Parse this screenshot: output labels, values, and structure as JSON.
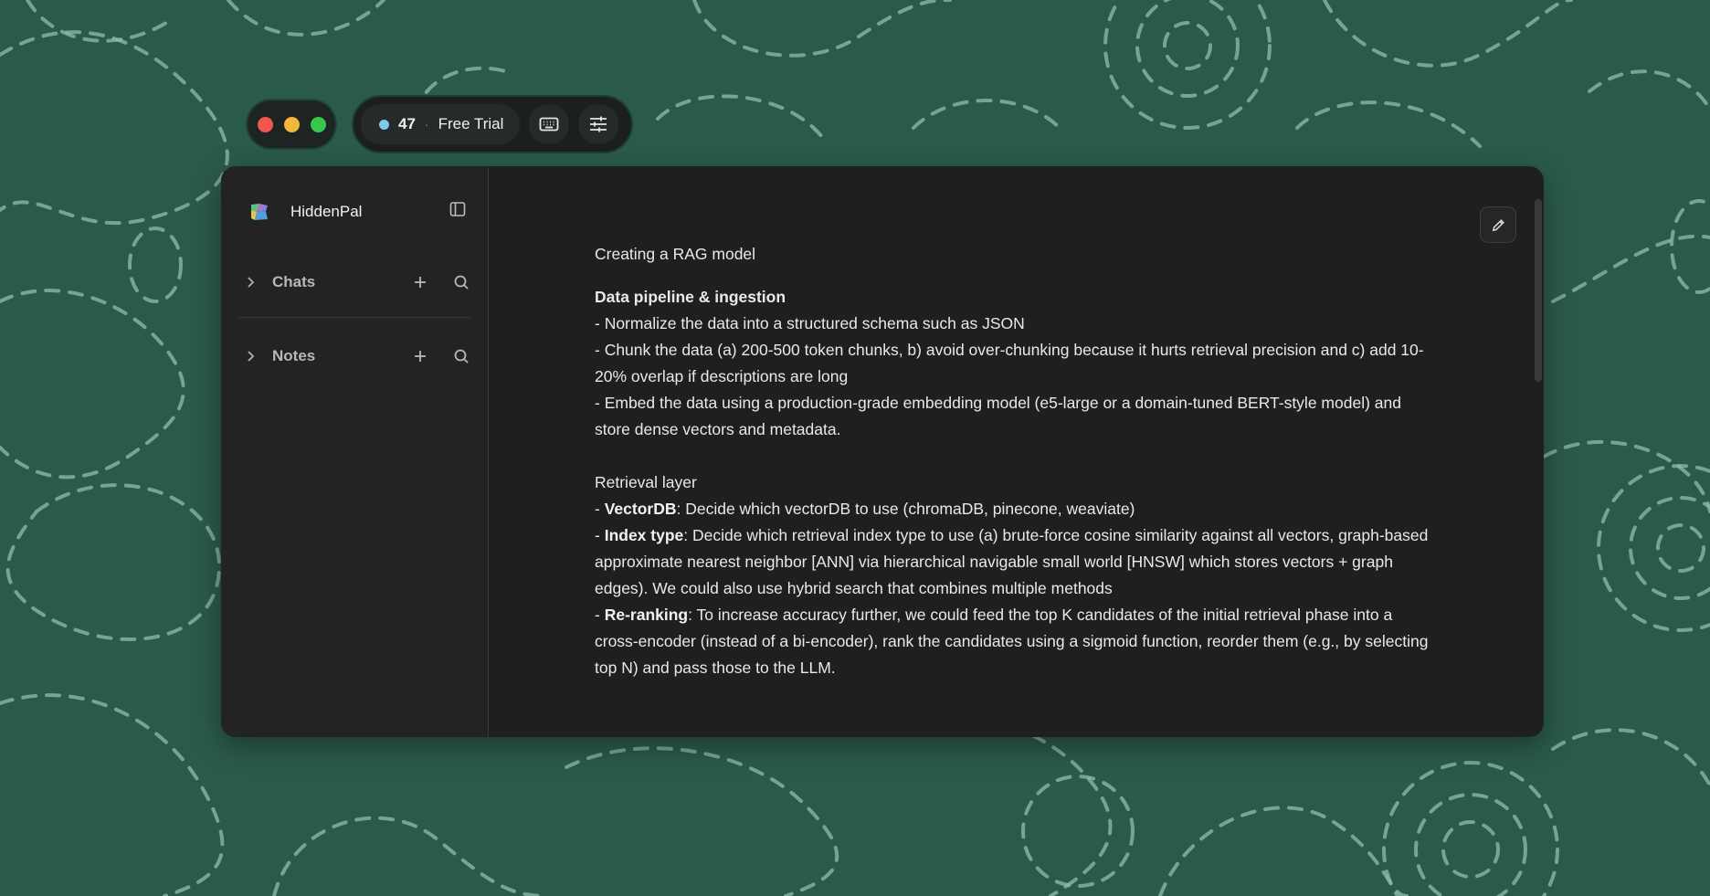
{
  "toolbar": {
    "credit_count": "47",
    "credit_separator": "·",
    "plan_label": "Free Trial",
    "keyboard_icon": "keyboard-icon",
    "settings_icon": "sliders-icon"
  },
  "sidebar": {
    "app_name": "HiddenPal",
    "sections": [
      {
        "label": "Chats"
      },
      {
        "label": "Notes"
      }
    ]
  },
  "note": {
    "title": "Creating a RAG model",
    "section1_heading": "Data pipeline & ingestion",
    "section1_lines": [
      "- Normalize the data into a structured schema such as JSON",
      "- Chunk the data (a) 200-500 token chunks, b) avoid over-chunking because it hurts retrieval precision and c) add 10-20% overlap if descriptions are long",
      "- Embed the data using a production-grade embedding model (e5-large or a domain-tuned BERT-style model) and store dense vectors and metadata."
    ],
    "section2_heading": "Retrieval layer",
    "section2_items": [
      {
        "prefix": "- ",
        "term": "VectorDB",
        "text": ": Decide which vectorDB to use (chromaDB, pinecone, weaviate)"
      },
      {
        "prefix": "- ",
        "term": "Index type",
        "text": ": Decide which retrieval index type to use (a) brute-force cosine similarity against all vectors, graph-based approximate nearest neighbor [ANN] via hierarchical navigable small world [HNSW] which stores vectors + graph edges). We could also use hybrid search that combines multiple methods"
      },
      {
        "prefix": "- ",
        "term": "Re-ranking",
        "text": ": To increase accuracy further, we could feed the top K candidates of the initial retrieval phase into a cross-encoder (instead of a bi-encoder), rank the candidates using a sigmoid function, reorder them (e.g., by selecting top N) and pass those to the LLM."
      }
    ]
  },
  "colors": {
    "background": "#2a5a4b",
    "window": "#1f1f1f",
    "sidebar": "#232323",
    "credit_dot": "#7fc8ee"
  }
}
